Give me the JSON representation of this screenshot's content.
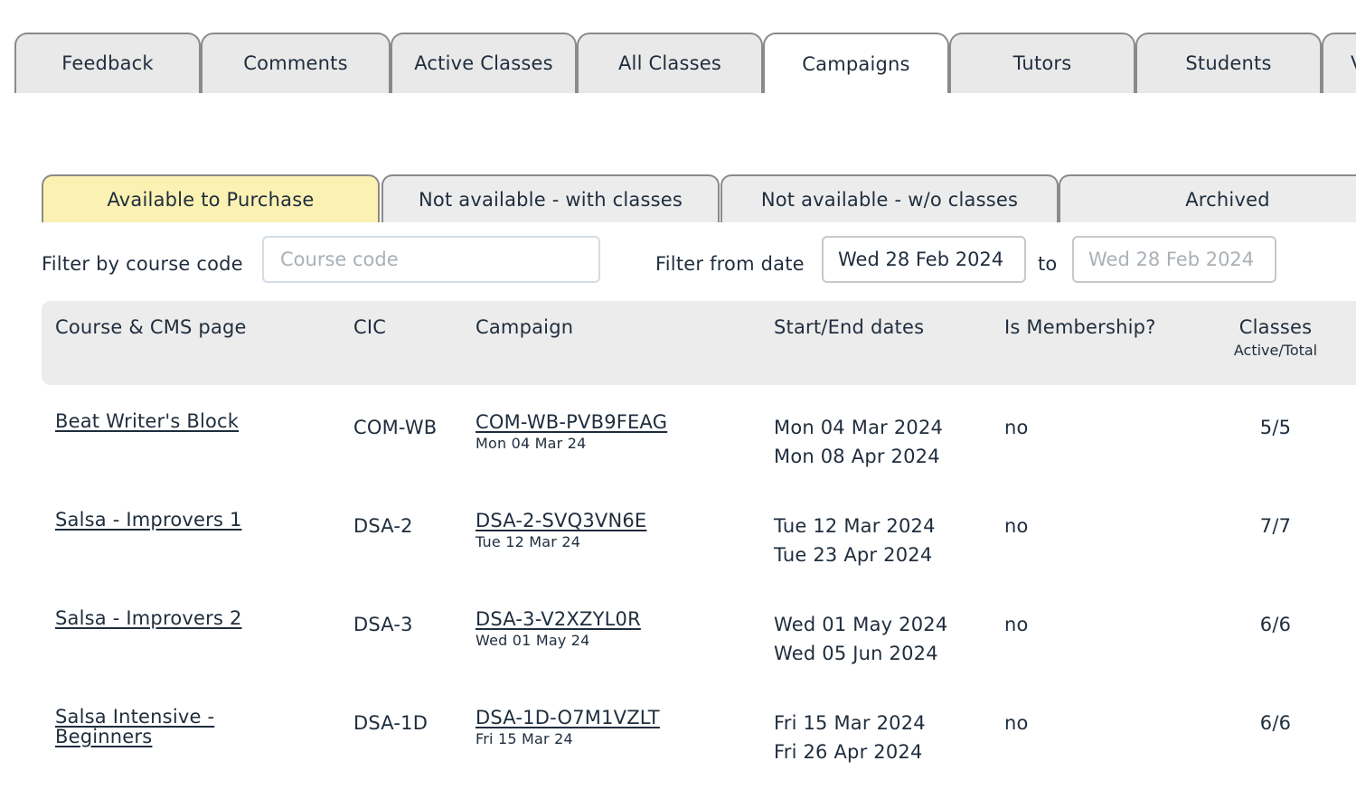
{
  "top_tabs": [
    {
      "label": "Feedback"
    },
    {
      "label": "Comments"
    },
    {
      "label": "Active Classes"
    },
    {
      "label": "All Classes"
    },
    {
      "label": "Campaigns"
    },
    {
      "label": "Tutors"
    },
    {
      "label": "Students"
    },
    {
      "label": "V"
    }
  ],
  "sub_tabs": [
    {
      "label": "Available to Purchase"
    },
    {
      "label": "Not available - with classes"
    },
    {
      "label": "Not available - w/o classes"
    },
    {
      "label": "Archived"
    }
  ],
  "filters": {
    "course_code_label": "Filter by course code",
    "course_code_placeholder": "Course code",
    "from_date_label": "Filter from date",
    "from_date_value": "Wed 28 Feb 2024",
    "to_label": "to",
    "to_date_placeholder": "Wed 28 Feb 2024"
  },
  "table": {
    "headers": {
      "course": "Course & CMS page",
      "cic": "CIC",
      "campaign": "Campaign",
      "dates": "Start/End dates",
      "membership": "Is Membership?",
      "classes": "Classes",
      "classes_sub": "Active/Total"
    },
    "rows": [
      {
        "course": "Beat Writer's Block",
        "cic": "COM-WB",
        "campaign": "COM-WB-PVB9FEAG",
        "campaign_date": "Mon 04 Mar 24",
        "start": "Mon 04 Mar 2024",
        "end": "Mon 08 Apr 2024",
        "membership": "no",
        "classes": "5/5"
      },
      {
        "course": "Salsa - Improvers 1",
        "cic": "DSA-2",
        "campaign": "DSA-2-SVQ3VN6E",
        "campaign_date": "Tue 12 Mar 24",
        "start": "Tue 12 Mar 2024",
        "end": "Tue 23 Apr 2024",
        "membership": "no",
        "classes": "7/7"
      },
      {
        "course": "Salsa - Improvers 2",
        "cic": "DSA-3",
        "campaign": "DSA-3-V2XZYL0R",
        "campaign_date": "Wed 01 May 24",
        "start": "Wed 01 May 2024",
        "end": "Wed 05 Jun 2024",
        "membership": "no",
        "classes": "6/6"
      },
      {
        "course": "Salsa Intensive - Beginners",
        "cic": "DSA-1D",
        "campaign": "DSA-1D-O7M1VZLT",
        "campaign_date": "Fri 15 Mar 24",
        "start": "Fri 15 Mar 2024",
        "end": "Fri 26 Apr 2024",
        "membership": "no",
        "classes": "6/6"
      }
    ]
  }
}
